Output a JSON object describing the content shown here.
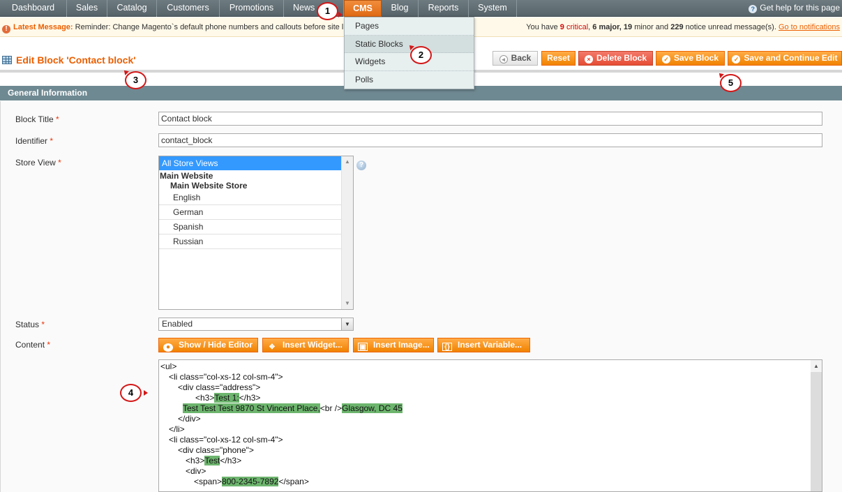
{
  "nav": {
    "items": [
      "Dashboard",
      "Sales",
      "Catalog",
      "Customers",
      "Promotions",
      "News",
      "CMS",
      "Blog",
      "Reports",
      "System"
    ],
    "help": "Get help for this page"
  },
  "message": {
    "label": "Latest Message:",
    "text": "Reminder: Change Magento`s default phone numbers and callouts before site l",
    "right_prefix": "You have",
    "critical_count": "9",
    "critical_label": "critical",
    "major": "6 major,",
    "minor_count": "19",
    "minor_label": "minor and",
    "notice_count": "229",
    "notice_label": "notice unread message(s).",
    "link": "Go to notifications"
  },
  "cms_menu": [
    "Pages",
    "Static Blocks",
    "Widgets",
    "Polls"
  ],
  "page": {
    "title": "Edit Block 'Contact block'"
  },
  "buttons": {
    "back": "Back",
    "reset": "Reset",
    "delete": "Delete Block",
    "save": "Save Block",
    "save_continue": "Save and Continue Edit"
  },
  "section": {
    "title": "General Information"
  },
  "form": {
    "block_title_label": "Block Title",
    "block_title_value": "Contact block",
    "identifier_label": "Identifier",
    "identifier_value": "contact_block",
    "store_view_label": "Store View",
    "store_options": {
      "selected": "All Store Views",
      "website": "Main Website",
      "store": "Main Website Store",
      "views": [
        "English",
        "German",
        "Spanish",
        "Russian"
      ]
    },
    "status_label": "Status",
    "status_value": "Enabled",
    "content_label": "Content",
    "required_mark": "*"
  },
  "editor_buttons": {
    "show_hide": "Show / Hide Editor",
    "widget": "Insert Widget...",
    "image": "Insert Image...",
    "variable": "Insert Variable..."
  },
  "content_code": {
    "l1": "<ul>",
    "l2": "<li class=\"col-xs-12 col-sm-4\">",
    "l3": "<div class=\"address\">",
    "l4a": "<h3>",
    "l4b": "Test 1:",
    "l4c": "</h3>",
    "l5a": "Test Test Test 9870 St Vincent Place,",
    "l5b": "<br />",
    "l5c": "Glasgow, DC 45",
    "l6": "</div>",
    "l7": "</li>",
    "l8": "<li class=\"col-xs-12 col-sm-4\">",
    "l9": "<div class=\"phone\">",
    "l10a": "<h3>",
    "l10b": "Test",
    "l10c": "</h3>",
    "l11": "<div>",
    "l12a": "<span>",
    "l12b": "800-2345-7892",
    "l12c": "</span>"
  },
  "callouts": [
    "1",
    "2",
    "3",
    "4",
    "5"
  ]
}
